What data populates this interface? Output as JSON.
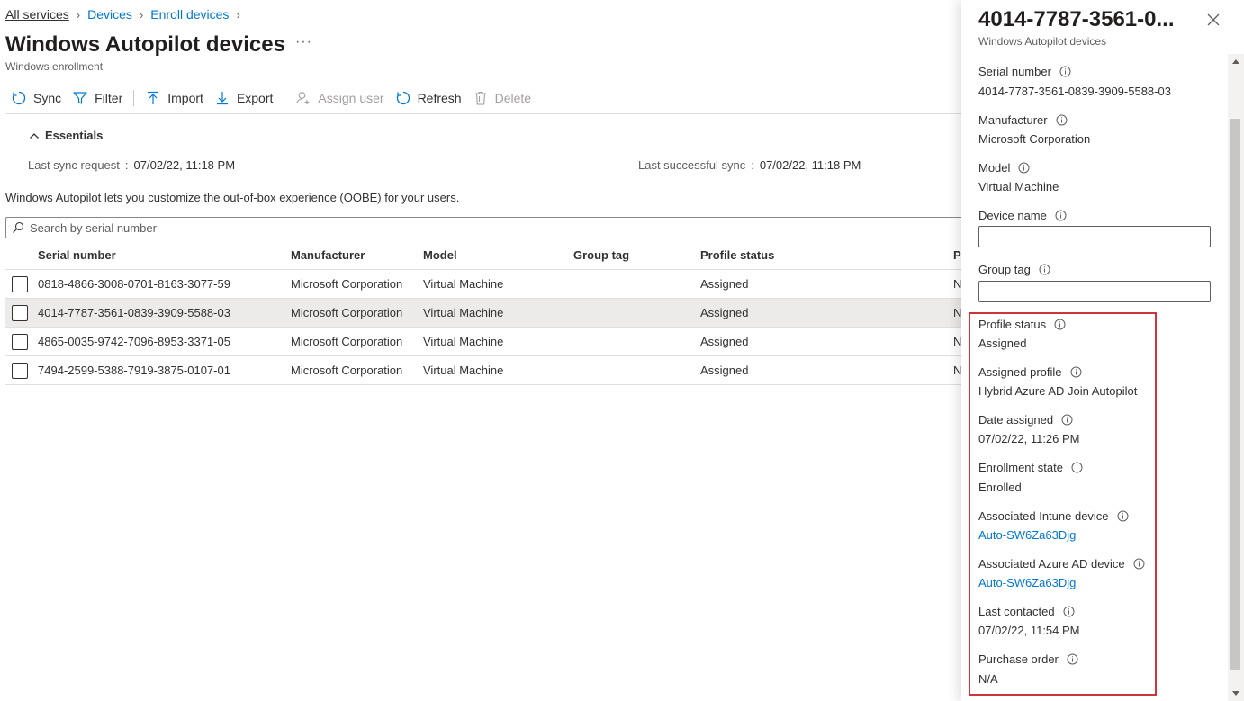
{
  "breadcrumb": {
    "items": [
      "All services",
      "Devices",
      "Enroll devices"
    ]
  },
  "page": {
    "title": "Windows Autopilot devices",
    "more": "···",
    "subtitle": "Windows enrollment"
  },
  "toolbar": {
    "sync": "Sync",
    "filter": "Filter",
    "import": "Import",
    "export": "Export",
    "assign_user": "Assign user",
    "refresh": "Refresh",
    "delete": "Delete"
  },
  "essentials": {
    "label": "Essentials",
    "last_sync_request_label": "Last sync request",
    "last_sync_request_value": "07/02/22, 11:18 PM",
    "last_successful_sync_label": "Last successful sync",
    "last_successful_sync_value": "07/02/22, 11:18 PM",
    "colon": ":"
  },
  "description": "Windows Autopilot lets you customize the out-of-box experience (OOBE) for your users.",
  "search": {
    "placeholder": "Search by serial number"
  },
  "grid": {
    "columns": {
      "serial": "Serial number",
      "manufacturer": "Manufacturer",
      "model": "Model",
      "group_tag": "Group tag",
      "profile_status": "Profile status",
      "extra": "P"
    },
    "rows": [
      {
        "serial": "0818-4866-3008-0701-8163-3077-59",
        "manufacturer": "Microsoft Corporation",
        "model": "Virtual Machine",
        "group_tag": "",
        "profile_status": "Assigned",
        "extra": "N"
      },
      {
        "serial": "4014-7787-3561-0839-3909-5588-03",
        "manufacturer": "Microsoft Corporation",
        "model": "Virtual Machine",
        "group_tag": "",
        "profile_status": "Assigned",
        "extra": "N"
      },
      {
        "serial": "4865-0035-9742-7096-8953-3371-05",
        "manufacturer": "Microsoft Corporation",
        "model": "Virtual Machine",
        "group_tag": "",
        "profile_status": "Assigned",
        "extra": "N"
      },
      {
        "serial": "7494-2599-5388-7919-3875-0107-01",
        "manufacturer": "Microsoft Corporation",
        "model": "Virtual Machine",
        "group_tag": "",
        "profile_status": "Assigned",
        "extra": "N"
      }
    ]
  },
  "panel": {
    "title": "4014-7787-3561-0...",
    "subtitle": "Windows Autopilot devices",
    "serial_label": "Serial number",
    "serial_value": "4014-7787-3561-0839-3909-5588-03",
    "manufacturer_label": "Manufacturer",
    "manufacturer_value": "Microsoft Corporation",
    "model_label": "Model",
    "model_value": "Virtual Machine",
    "device_name_label": "Device name",
    "device_name_value": "",
    "group_tag_label": "Group tag",
    "group_tag_value": "",
    "profile_status_label": "Profile status",
    "profile_status_value": "Assigned",
    "assigned_profile_label": "Assigned profile",
    "assigned_profile_value": "Hybrid Azure AD Join Autopilot",
    "date_assigned_label": "Date assigned",
    "date_assigned_value": "07/02/22, 11:26 PM",
    "enrollment_state_label": "Enrollment state",
    "enrollment_state_value": "Enrolled",
    "intune_device_label": "Associated Intune device",
    "intune_device_value": "Auto-SW6Za63Djg",
    "azure_ad_device_label": "Associated Azure AD device",
    "azure_ad_device_value": "Auto-SW6Za63Djg",
    "last_contacted_label": "Last contacted",
    "last_contacted_value": "07/02/22, 11:54 PM",
    "purchase_order_label": "Purchase order",
    "purchase_order_value": "N/A"
  },
  "colors": {
    "accent": "#0078d4",
    "highlight": "#d13438",
    "selected_row": "#edebe9"
  },
  "icons": [
    "sync-icon",
    "filter-icon",
    "import-icon",
    "export-icon",
    "assign-user-icon",
    "refresh-icon",
    "delete-icon",
    "chevron-up-icon",
    "search-icon",
    "close-icon",
    "info-icon"
  ]
}
